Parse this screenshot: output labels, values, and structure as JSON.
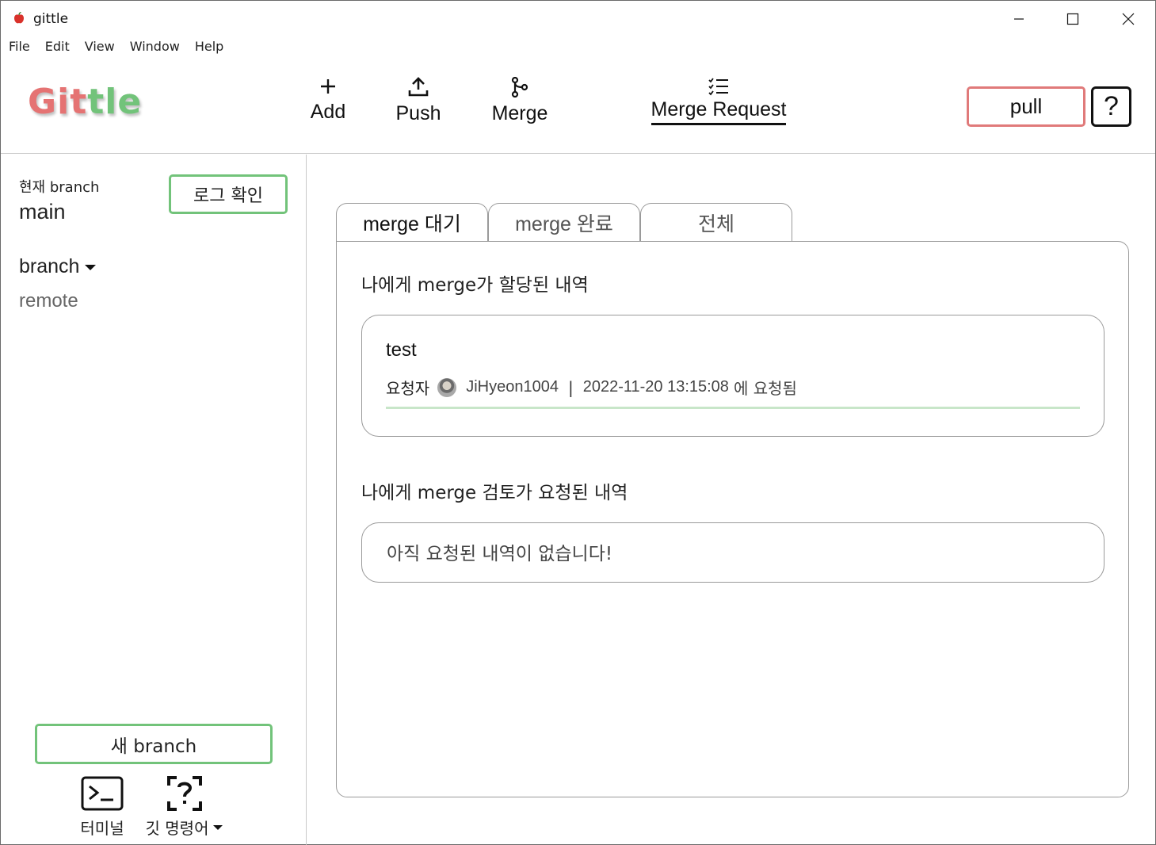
{
  "window": {
    "title": "gittle",
    "minimize_icon": "minimize-icon",
    "maximize_icon": "maximize-icon",
    "close_icon": "close-icon"
  },
  "menu": {
    "items": [
      "File",
      "Edit",
      "View",
      "Window",
      "Help"
    ]
  },
  "toolbar": {
    "logo_part1": "Git",
    "logo_part2": "tle",
    "logo_colors": {
      "part1": "#e57373",
      "part2": "#72c37a"
    },
    "add_label": "Add",
    "push_label": "Push",
    "merge_label": "Merge",
    "merge_request_label": "Merge Request",
    "pull_label": "pull",
    "help_label": "?"
  },
  "sidebar": {
    "current_branch_label": "현재 branch",
    "current_branch": "main",
    "log_button": "로그 확인",
    "branch_toggle": "branch",
    "remote_toggle": "remote",
    "new_branch_button": "새 branch",
    "terminal_label": "터미널",
    "git_commands_label": "깃 명령어"
  },
  "main": {
    "tabs": [
      {
        "label": "merge 대기",
        "active": true
      },
      {
        "label": "merge 완료",
        "active": false
      },
      {
        "label": "전체",
        "active": false
      }
    ],
    "assigned_section_title": "나에게 merge가 할당된 내역",
    "assigned_items": [
      {
        "title": "test",
        "requester_label": "요청자",
        "requester": "JiHyeon1004",
        "separator": "|",
        "requested_at": "2022-11-20 13:15:08",
        "requested_suffix": "에 요청됨"
      }
    ],
    "review_section_title": "나에게 merge 검토가 요청된 내역",
    "review_empty_text": "아직 요청된 내역이 없습니다!"
  },
  "colors": {
    "accent_green": "#72c37a",
    "accent_red": "#e07a7a",
    "card_divider": "#c8e6c9"
  }
}
